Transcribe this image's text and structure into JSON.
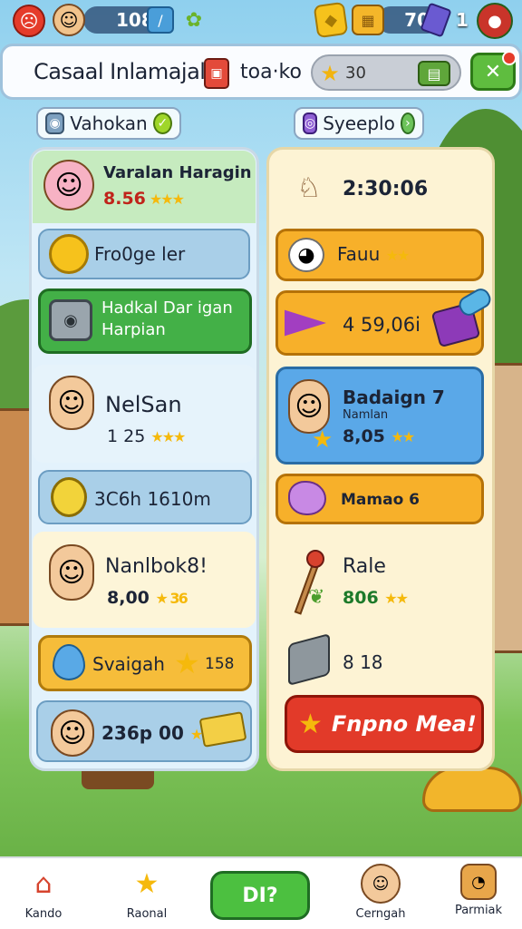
{
  "topbar": {
    "coins": "1080",
    "gems_count": "70",
    "gem_secondary": "1"
  },
  "titlebar": {
    "title": "Casaal Inlamajal",
    "title_suffix": "toa·ko",
    "search_value": "30"
  },
  "sections": {
    "left_header": "Vahokan",
    "right_header": "Syeeplo"
  },
  "left_panel": {
    "profile": {
      "name": "Varalan Haragin",
      "score": "8.56",
      "stars": "★★★"
    },
    "action_blue": {
      "label": "Fro0ge ler"
    },
    "action_green": {
      "line1": "Hadkal Dar igan",
      "line2": "Harpian"
    },
    "player_nelsan": {
      "name": "NelSan",
      "score": "1 25",
      "stars": "★★★"
    },
    "action_blue2": {
      "label": "3C6h 1610m"
    },
    "player_nanibok": {
      "name": "Nanlbok8!",
      "score": "8,00",
      "stars": "★ 36"
    },
    "action_orange": {
      "label": "Svaigah",
      "number": "158"
    },
    "bottom_card": {
      "label": "236p 00",
      "stars": "★"
    }
  },
  "right_panel": {
    "top_value": "2:30:06",
    "fauu": {
      "label": "Fauu",
      "stars": "★★"
    },
    "value_4590": "4 59,06i",
    "badaign": {
      "name": "Badaign 7",
      "subtitle": "Namlan",
      "score": "8,05",
      "stars": "★★"
    },
    "mamao": {
      "label": "Mamao 6"
    },
    "rale": {
      "name": "Rale",
      "score": "806",
      "stars": "★★"
    },
    "item_818": "8 18",
    "promo": {
      "label": "Fnpno Mea!"
    }
  },
  "nav": {
    "home": "Kando",
    "favorites": "Raonal",
    "center": "DI?",
    "cerngah": "Cerngah",
    "pet": "Parmiak"
  },
  "colors": {
    "accent_green": "#43b047",
    "accent_orange": "#f7b02a",
    "accent_blue": "#5aa8e8",
    "promo_red": "#e23a29",
    "star_gold": "#f5b90c"
  },
  "icons": {
    "topbar": [
      "angry-face-icon",
      "avatar-icon",
      "slash-icon",
      "monster-icon",
      "gold-bar-icon",
      "chest-icon",
      "gem-icon",
      "bomb-icon"
    ],
    "nav": [
      "home-icon",
      "star-icon",
      "face-icon",
      "pet-icon"
    ]
  }
}
